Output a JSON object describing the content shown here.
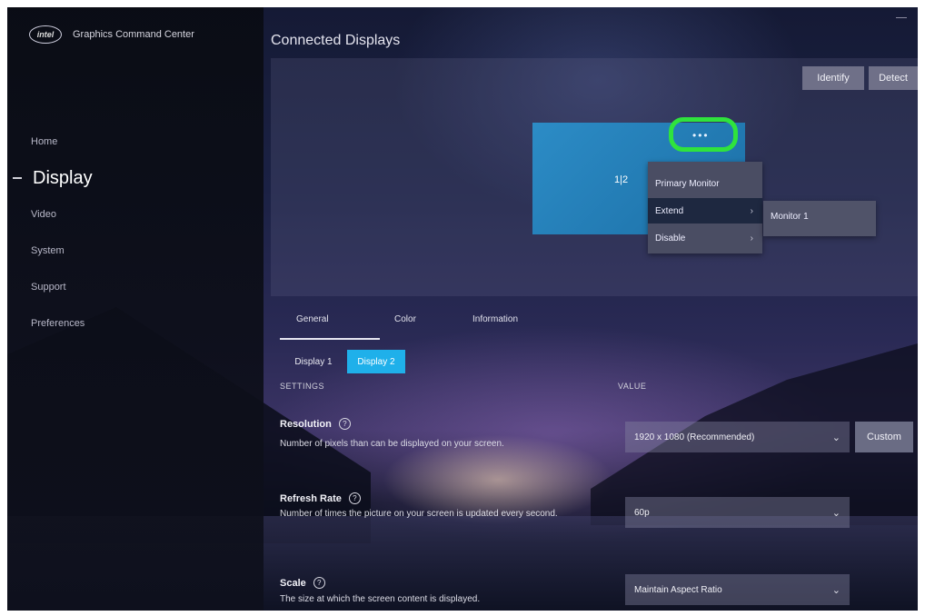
{
  "app": {
    "title": "Graphics Command Center",
    "logo_text": "intel"
  },
  "sidebar": {
    "items": [
      {
        "label": "Home"
      },
      {
        "label": "Display"
      },
      {
        "label": "Video"
      },
      {
        "label": "System"
      },
      {
        "label": "Support"
      },
      {
        "label": "Preferences"
      }
    ],
    "active_index": 1
  },
  "header": {
    "title": "Connected Displays"
  },
  "preview": {
    "identify_label": "Identify",
    "detect_label": "Detect",
    "monitor_label": "1|2",
    "more_label": "•••",
    "context_menu": {
      "items": [
        {
          "label": "Primary Monitor"
        },
        {
          "label": "Extend"
        },
        {
          "label": "Disable"
        }
      ],
      "submenu_item": "Monitor 1"
    }
  },
  "tabs": [
    {
      "label": "General"
    },
    {
      "label": "Color"
    },
    {
      "label": "Information"
    }
  ],
  "display_selector": {
    "items": [
      "Display 1",
      "Display 2"
    ],
    "selected": "Display 2"
  },
  "columns": {
    "settings": "SETTINGS",
    "value": "VALUE"
  },
  "settings": {
    "resolution": {
      "title": "Resolution",
      "description": "Number of pixels than can be displayed on your screen.",
      "value": "1920 x 1080 (Recommended)",
      "custom_label": "Custom"
    },
    "refresh_rate": {
      "title": "Refresh Rate",
      "description": "Number of times the picture on your screen is updated every second.",
      "value": "60p"
    },
    "scale": {
      "title": "Scale",
      "description": "The size at which the screen content is displayed.",
      "value": "Maintain Aspect Ratio"
    }
  },
  "colors": {
    "accent": "#1fb0ea",
    "highlight": "#2fe33d",
    "monitor": "#2c8cc6"
  }
}
